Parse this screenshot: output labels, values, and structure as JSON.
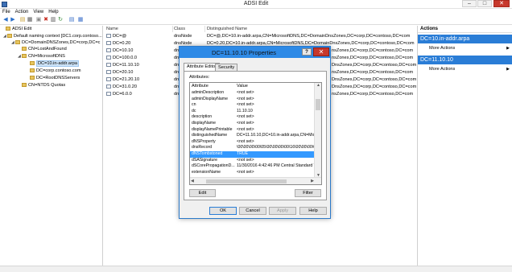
{
  "window": {
    "title": "ADSI Edit",
    "controls": {
      "minimize": "–",
      "maximize": "□",
      "close": "✕"
    }
  },
  "menu": [
    "File",
    "Action",
    "View",
    "Help"
  ],
  "tree": {
    "items": [
      {
        "label": "ADSI Edit",
        "expander": "",
        "level": 0
      },
      {
        "label": "Default naming context [DC1.corp.contoso...",
        "expander": "◢",
        "level": 1
      },
      {
        "label": "DC=DomainDNSZones,DC=corp,DC=c",
        "expander": "◢",
        "level": 2
      },
      {
        "label": "CN=LostAndFound",
        "expander": "",
        "level": 3
      },
      {
        "label": "CN=MicrosoftDNS",
        "expander": "◢",
        "level": 3
      },
      {
        "label": "DC=10.in-addr.arpa",
        "expander": "",
        "level": 4,
        "selected": true
      },
      {
        "label": "DC=corp.contoso.com",
        "expander": "",
        "level": 4
      },
      {
        "label": "DC=RootDNSServers",
        "expander": "",
        "level": 4
      },
      {
        "label": "CN=NTDS Quotas",
        "expander": "",
        "level": 3
      }
    ]
  },
  "list": {
    "columns": [
      "Name",
      "Class",
      "Distinguished Name"
    ],
    "rows": [
      {
        "name": "DC=@",
        "class": "dnsNode",
        "dn": "DC=@,DC=10.in-addr.arpa,CN=MicrosoftDNS,DC=DomainDnsZones,DC=corp,DC=contoso,DC=com"
      },
      {
        "name": "DC=0.20",
        "class": "dnsNode",
        "dn": "DC=0.20,DC=10.in-addr.arpa,CN=MicrosoftDNS,DC=DomainDnsZones,DC=corp,DC=contoso,DC=com"
      },
      {
        "name": "DC=10.10",
        "class": "dn",
        "dn": "nsZones,DC=corp,DC=contoso,DC=com"
      },
      {
        "name": "DC=100.0.0",
        "class": "dn",
        "dn": "nsZones,DC=corp,DC=contoso,DC=com"
      },
      {
        "name": "DC=11.10.10",
        "class": "dn",
        "dn": "DnsZones,DC=corp,DC=contoso,DC=com"
      },
      {
        "name": "DC=20.10",
        "class": "dn",
        "dn": "nsZones,DC=corp,DC=contoso,DC=com"
      },
      {
        "name": "DC=21.20.10",
        "class": "dn",
        "dn": "DnsZones,DC=corp,DC=contoso,DC=com"
      },
      {
        "name": "DC=31.0.20",
        "class": "dn",
        "dn": "DnsZones,DC=corp,DC=contoso,DC=com"
      },
      {
        "name": "DC=6.0.0",
        "class": "dn",
        "dn": "nsZones,DC=corp,DC=contoso,DC=com"
      }
    ]
  },
  "actions": {
    "header": "Actions",
    "sections": [
      {
        "title": "DC=10.in-addr.arpa",
        "items": [
          "More Actions"
        ]
      },
      {
        "title": "DC=11.10.10",
        "items": [
          "More Actions"
        ]
      }
    ]
  },
  "dialog": {
    "title": "DC=11.10.10 Properties",
    "help_glyph": "?",
    "close_glyph": "✕",
    "tabs": [
      "Attribute Editor",
      "Security"
    ],
    "attributes_label": "Attributes:",
    "grid_headers": [
      "Attribute",
      "Value"
    ],
    "rows": [
      {
        "attr": "adminDescription",
        "value": "<not set>"
      },
      {
        "attr": "adminDisplayName",
        "value": "<not set>"
      },
      {
        "attr": "cn",
        "value": "<not set>"
      },
      {
        "attr": "dc",
        "value": "11.10.10"
      },
      {
        "attr": "description",
        "value": "<not set>"
      },
      {
        "attr": "displayName",
        "value": "<not set>"
      },
      {
        "attr": "displayNamePrintable",
        "value": "<not set>"
      },
      {
        "attr": "distinguishedName",
        "value": "DC=11.10.10,DC=10.in-addr.arpa,CN=Micro"
      },
      {
        "attr": "dNSProperty",
        "value": "<not set>"
      },
      {
        "attr": "dnsRecord",
        "value": "\\00\\00\\00\\00\\05\\00\\00\\00\\00\\16\\00\\00\\00\\00"
      },
      {
        "attr": "dNSTombstoned",
        "value": "TRUE",
        "selected": true
      },
      {
        "attr": "dSASignature",
        "value": "<not set>"
      },
      {
        "attr": "dSCorePropagationD...",
        "value": "11/30/2016 4:42:46 PM Central Standard Ti"
      },
      {
        "attr": "extensionName",
        "value": "<not set>"
      }
    ],
    "buttons": {
      "edit": "Edit",
      "filter": "Filter",
      "ok": "OK",
      "cancel": "Cancel",
      "apply": "Apply",
      "help": "Help"
    }
  }
}
